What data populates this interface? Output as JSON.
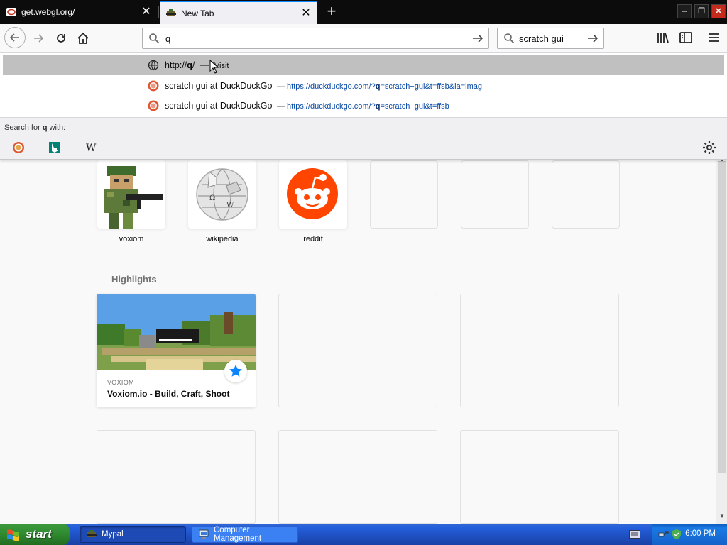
{
  "tabs": [
    {
      "title": "get.webgl.org/",
      "active": false
    },
    {
      "title": "New Tab",
      "active": true
    }
  ],
  "urlbar": {
    "value": "q",
    "placeholder": ""
  },
  "searchbar": {
    "value": "scratch gui",
    "placeholder": ""
  },
  "popup": {
    "rows": [
      {
        "title_prefix": "http://",
        "title_bold": "q",
        "title_suffix": "/",
        "action": "Visit",
        "url_pre": "",
        "url_bold": "",
        "url_post": "",
        "icon": "globe-icon",
        "selected": true
      },
      {
        "title_prefix": "scratch gui at DuckDuckGo",
        "title_bold": "",
        "title_suffix": "",
        "action": "",
        "url_pre": "https://duckduckgo.com/?",
        "url_bold": "q",
        "url_post": "=scratch+gui&t=ffsb&ia=imag",
        "icon": "duckduckgo-icon",
        "selected": false
      },
      {
        "title_prefix": "scratch gui at DuckDuckGo",
        "title_bold": "",
        "title_suffix": "",
        "action": "",
        "url_pre": "https://duckduckgo.com/?",
        "url_bold": "q",
        "url_post": "=scratch+gui&t=ffsb",
        "icon": "duckduckgo-icon",
        "selected": false
      }
    ],
    "search_for_prefix": "Search for ",
    "search_for_term": "q",
    "search_for_suffix": " with:",
    "engines": [
      "duckduckgo-icon",
      "bing-icon",
      "wikipedia-icon"
    ]
  },
  "top_sites": [
    {
      "label": "voxiom"
    },
    {
      "label": "wikipedia"
    },
    {
      "label": "reddit"
    },
    {
      "label": ""
    },
    {
      "label": ""
    },
    {
      "label": ""
    }
  ],
  "highlights": {
    "title": "Highlights",
    "cards": [
      {
        "site": "VOXIOM",
        "title": "Voxiom.io - Build, Craft, Shoot",
        "icon": "star-icon"
      }
    ]
  },
  "taskbar": {
    "start_label": "start",
    "items": [
      {
        "label": "Mypal",
        "active": true
      },
      {
        "label": "Computer Management",
        "active": false
      }
    ],
    "clock": "6:00 PM"
  },
  "colors": {
    "accent": "#0a84ff",
    "reddit": "#ff4500",
    "highlight_star": "#0a84ff"
  }
}
